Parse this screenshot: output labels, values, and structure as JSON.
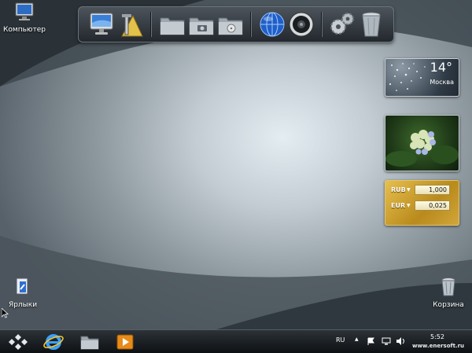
{
  "desktop": {
    "icons": {
      "computer": "Компьютер",
      "shortcuts": "Ярлыки",
      "recycle": "Корзина"
    }
  },
  "dock": {
    "items": [
      "computer-icon",
      "tools-icon",
      "folder-icon",
      "camera-folder-icon",
      "music-folder-icon",
      "globe-icon",
      "speaker-icon",
      "gears-icon",
      "trash-icon"
    ]
  },
  "gadgets": {
    "weather": {
      "temperature": "14°",
      "city": "Москва"
    },
    "currency": {
      "rows": [
        {
          "code": "RUB",
          "value": "1,000"
        },
        {
          "code": "EUR",
          "value": "0,025"
        }
      ]
    }
  },
  "taskbar": {
    "language": "RU",
    "time": "5:52",
    "watermark": "www.enersoft.ru"
  },
  "colors": {
    "taskbar": "#0c0f12",
    "gold": "#d2a63a"
  }
}
